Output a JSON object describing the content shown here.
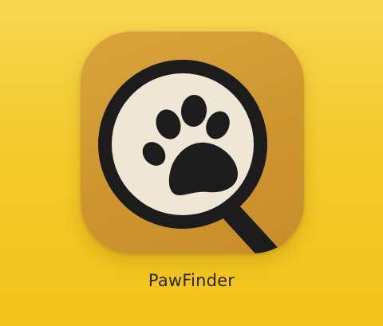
{
  "app": {
    "name": "PawFinder",
    "icon": "paw-magnifier-icon"
  },
  "colors": {
    "background": "#f4ca2c",
    "tile": "#cf9630",
    "lens": "#efe6d6",
    "ink": "#1c1c1c",
    "label": "#2b2418"
  }
}
